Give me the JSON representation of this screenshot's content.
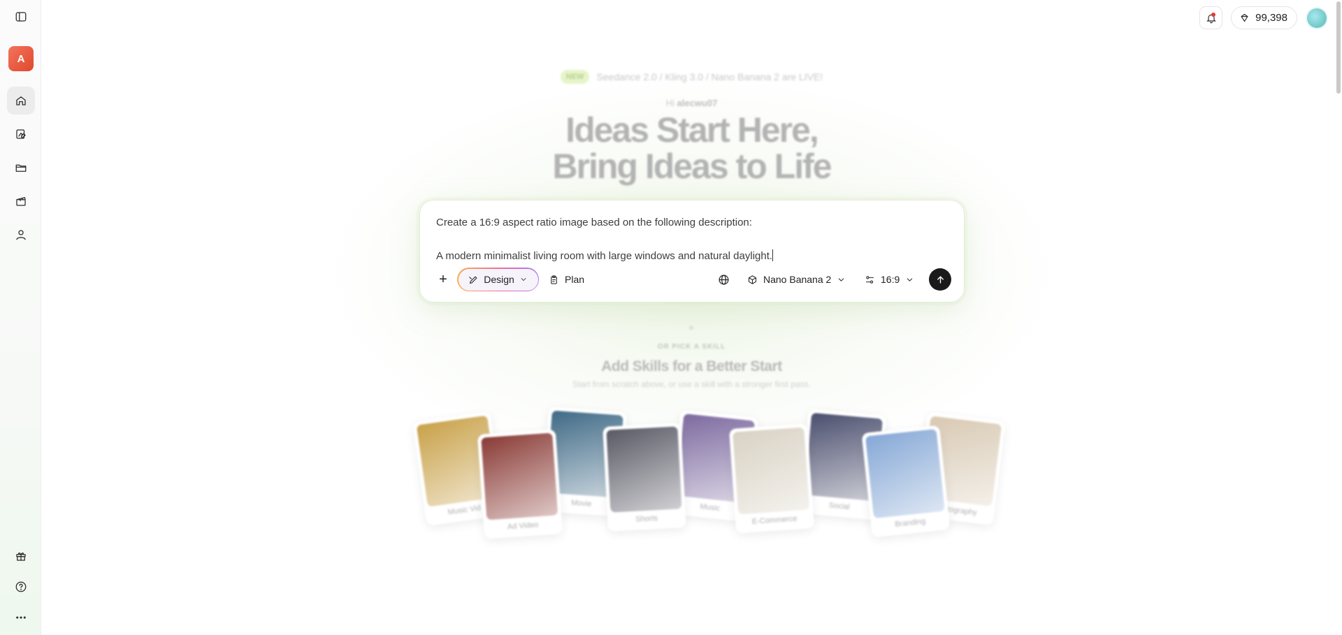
{
  "sidebar": {
    "workspace_initial": "A",
    "nav": [
      {
        "id": "toggle",
        "icon": "sidebar-toggle-icon"
      },
      {
        "id": "home",
        "icon": "home-icon",
        "active": true
      },
      {
        "id": "assets",
        "icon": "image-edit-icon"
      },
      {
        "id": "projects",
        "icon": "folder-icon"
      },
      {
        "id": "videos",
        "icon": "clapperboard-icon"
      },
      {
        "id": "profile",
        "icon": "user-icon"
      },
      {
        "id": "gift",
        "icon": "gift-icon"
      },
      {
        "id": "help",
        "icon": "help-circle-icon"
      },
      {
        "id": "more",
        "icon": "more-horizontal-icon"
      }
    ]
  },
  "topbar": {
    "credits": "99,398",
    "has_notification": true
  },
  "hero": {
    "badge": "NEW",
    "announcement": "Seedance 2.0 / Kling 3.0 / Nano Banana 2 are LIVE!",
    "greeting_prefix": "Hi",
    "username": "alecwu07",
    "title_line1": "Ideas Start Here,",
    "title_line2": "Bring Ideas to Life"
  },
  "prompt": {
    "line1": "Create a 16:9 aspect ratio image based on the following description:",
    "line2": "A modern minimalist living room with large windows and natural daylight.",
    "mode_label": "Design",
    "plan_label": "Plan",
    "model_label": "Nano Banana 2",
    "ratio_label": "16:9"
  },
  "skills": {
    "eyebrow": "OR PICK A SKILL",
    "title": "Add Skills for a Better Start",
    "subtitle": "Start from scratch above, or use a skill with a stronger first pass.",
    "tiles": [
      {
        "label": "Music Vid",
        "color": "#c9a24a"
      },
      {
        "label": "Ad Video",
        "color": "#8a3b36"
      },
      {
        "label": "Movie",
        "color": "#3f6a86"
      },
      {
        "label": "Shorts",
        "color": "#5a5a66"
      },
      {
        "label": "Music",
        "color": "#7d6aa0"
      },
      {
        "label": "E-Commerce",
        "color": "#d9d2c4"
      },
      {
        "label": "Social",
        "color": "#4b4f6e"
      },
      {
        "label": "Branding",
        "color": "#86a8d6"
      },
      {
        "label": "Photography",
        "color": "#d8c9b3"
      }
    ]
  }
}
